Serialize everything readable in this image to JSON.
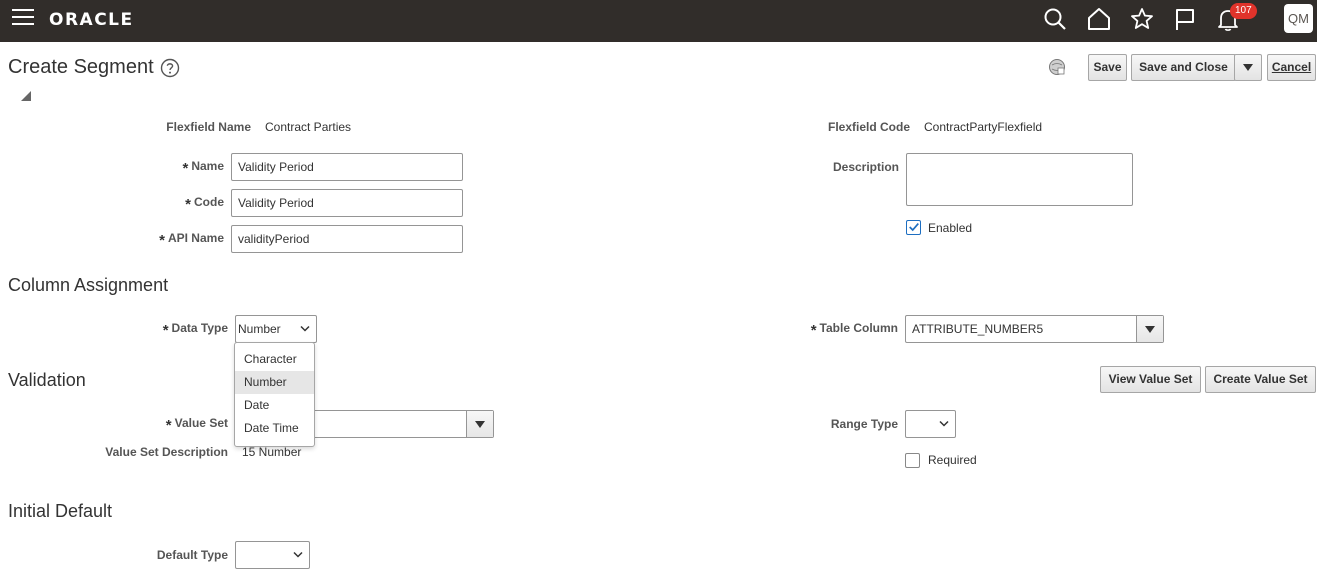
{
  "header": {
    "logo": "ORACLE",
    "notification_count": "107",
    "avatar_initials": "QM"
  },
  "title": "Create Segment",
  "toolbar": {
    "save": "Save",
    "save_and_close": "Save and Close",
    "cancel": "Cancel"
  },
  "flexfield": {
    "name_label": "Flexfield Name",
    "name_value": "Contract Parties",
    "code_label": "Flexfield Code",
    "code_value": "ContractPartyFlexfield"
  },
  "fields": {
    "name_label": "Name",
    "name_value": "Validity Period",
    "code_label": "Code",
    "code_value": "Validity Period",
    "api_label": "API Name",
    "api_value": "validityPeriod",
    "description_label": "Description",
    "description_value": "",
    "enabled_label": "Enabled",
    "enabled_checked": true
  },
  "column_assignment": {
    "heading": "Column Assignment",
    "data_type_label": "Data Type",
    "data_type_value": "Number",
    "data_type_options": [
      "Character",
      "Number",
      "Date",
      "Date Time"
    ],
    "table_column_label": "Table Column",
    "table_column_value": "ATTRIBUTE_NUMBER5"
  },
  "validation": {
    "heading": "Validation",
    "view_value_set": "View Value Set",
    "create_value_set": "Create Value Set",
    "value_set_label": "Value Set",
    "value_set_value": "",
    "value_set_desc_label": "Value Set Description",
    "value_set_desc_value": "15 Number",
    "range_type_label": "Range Type",
    "range_type_value": "",
    "required_label": "Required",
    "required_checked": false
  },
  "initial_default": {
    "heading": "Initial Default",
    "default_type_label": "Default Type",
    "default_type_value": ""
  },
  "colors": {
    "header_bg": "#312d2a",
    "badge": "#e0332b",
    "checkbox_check": "#1d6ec1"
  }
}
